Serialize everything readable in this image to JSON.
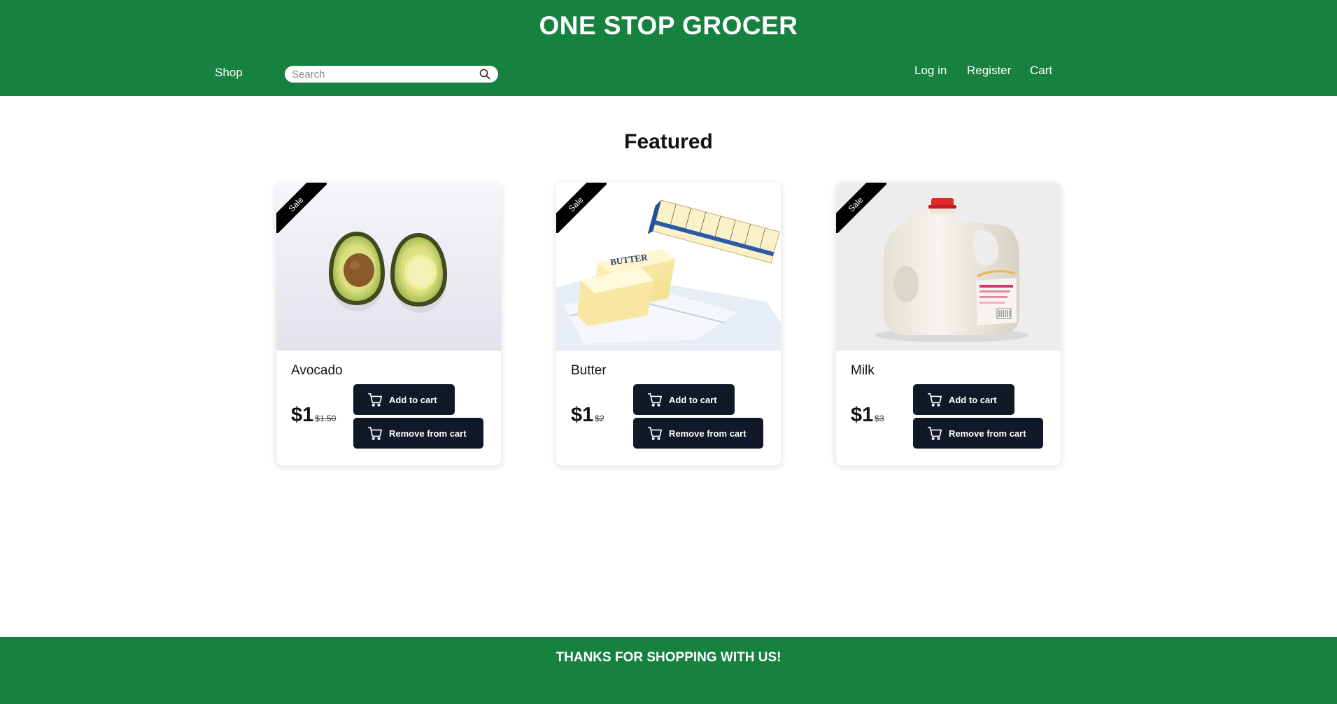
{
  "header": {
    "brand": "ONE STOP GROCER",
    "nav": {
      "shop": "Shop",
      "login": "Log in",
      "register": "Register",
      "cart": "Cart"
    },
    "search": {
      "placeholder": "Search",
      "value": ""
    }
  },
  "main": {
    "heading": "Featured",
    "products": [
      {
        "name": "Avocado",
        "badge": "Sale",
        "price": "$1",
        "old_price": "$1.50",
        "add_label": "Add to cart",
        "remove_label": "Remove from cart"
      },
      {
        "name": "Butter",
        "badge": "Sale",
        "price": "$1",
        "old_price": "$2",
        "add_label": "Add to cart",
        "remove_label": "Remove from cart"
      },
      {
        "name": "Milk",
        "badge": "Sale",
        "price": "$1",
        "old_price": "$3",
        "add_label": "Add to cart",
        "remove_label": "Remove from cart"
      }
    ]
  },
  "footer": {
    "text": "THANKS FOR SHOPPING WITH US!"
  },
  "colors": {
    "brand_green": "#17813f",
    "button_dark": "#111827",
    "ribbon": "#000000"
  },
  "icons": {
    "search": "search-icon",
    "cart": "cart-icon"
  }
}
